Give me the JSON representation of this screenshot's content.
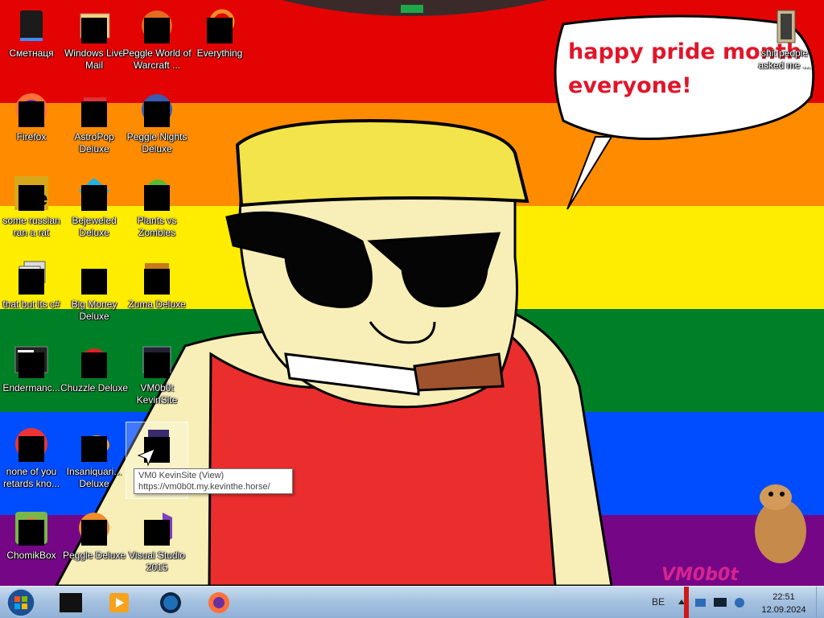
{
  "desktop": {
    "icons": [
      {
        "label": "Сметнаця",
        "icon": "recycle-bin-icon"
      },
      {
        "label": "Windows Live Mail",
        "icon": "windows-live-mail-icon"
      },
      {
        "label": "Peggle World of Warcraft ...",
        "icon": "peggle-wow-icon"
      },
      {
        "label": "Everything",
        "icon": "everything-search-icon"
      },
      {
        "label": "Firefox",
        "icon": "firefox-icon"
      },
      {
        "label": "AstroPop Deluxe",
        "icon": "astropop-icon"
      },
      {
        "label": "Peggle Nights Deluxe",
        "icon": "peggle-nights-icon"
      },
      {
        "label": "some russian ran a rat",
        "icon": "folder-image-icon"
      },
      {
        "label": "Bejeweled Deluxe",
        "icon": "bejeweled-icon"
      },
      {
        "label": "Plants vs Zombies",
        "icon": "plants-vs-zombies-icon"
      },
      {
        "label": "that but its c#",
        "icon": "shortcut-stack-icon"
      },
      {
        "label": "Big Money Deluxe",
        "icon": "big-money-icon"
      },
      {
        "label": "Zuma Deluxe",
        "icon": "zuma-icon"
      },
      {
        "label": "Endermanc...",
        "icon": "terminal-icon"
      },
      {
        "label": "Chuzzle Deluxe",
        "icon": "chuzzle-icon"
      },
      {
        "label": "VM0b0t KevinSite",
        "icon": "vm0b0t-icon"
      },
      {
        "label": "none of you retards kno...",
        "icon": "chrome-like-icon"
      },
      {
        "label": "Insaniquari... Deluxe",
        "icon": "insaniquarium-icon"
      },
      {
        "label": "VM0 KevinSite (View)",
        "icon": "link-shortcut-icon"
      },
      {
        "label": "ChomikBox",
        "icon": "chomikbox-icon"
      },
      {
        "label": "Peggle Deluxe",
        "icon": "peggle-icon"
      },
      {
        "label": "Visual Studio 2015",
        "icon": "visual-studio-icon"
      },
      {
        "label": "shit people asked me ...",
        "icon": "folder-icon"
      }
    ],
    "tooltip": {
      "title": "VM0 KevinSite (View)",
      "url": "https://vm0b0t.my.kevinthe.horse/"
    }
  },
  "wallpaper": {
    "speech_line1": "happy pride month",
    "speech_line2": "everyone!",
    "signature": "VM0b0t",
    "stripe_colors": [
      "#e40303",
      "#ff8c00",
      "#ffed00",
      "#008026",
      "#004dff",
      "#750787"
    ]
  },
  "taskbar": {
    "start_icon": "windows-orb-icon",
    "pinned": [
      {
        "name": "terminal",
        "icon": "black-box-icon"
      },
      {
        "name": "media player",
        "icon": "media-player-icon"
      },
      {
        "name": "globe app",
        "icon": "globe-icon"
      },
      {
        "name": "firefox",
        "icon": "firefox-icon"
      }
    ],
    "language": "BE",
    "time": "22:51",
    "date": "12.09.2024"
  }
}
